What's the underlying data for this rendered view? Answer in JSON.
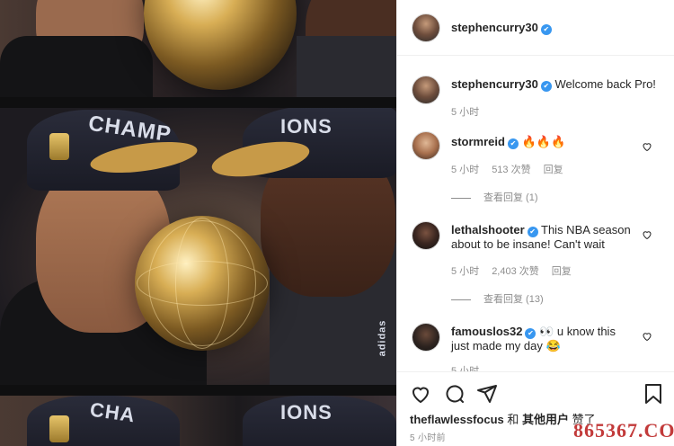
{
  "post": {
    "author": "stephencurry30",
    "caption": "Welcome back Pro!",
    "caption_time": "5 小时",
    "verified_mark": "✔"
  },
  "comments": [
    {
      "user": "stormreid",
      "text": "🔥🔥🔥",
      "time": "5 小时",
      "likes": "513 次赞",
      "reply": "回复",
      "view_replies": "查看回复 (1)"
    },
    {
      "user": "lethalshooter",
      "text": "This NBA season about to be insane! Can't wait",
      "time": "5 小时",
      "likes": "2,403 次赞",
      "reply": "回复",
      "view_replies": "查看回复 (13)"
    },
    {
      "user": "famouslos32",
      "text": "👀 u know this just made my day 😂",
      "time": "5 小时"
    }
  ],
  "liked_by": {
    "user": "theflawlessfocus",
    "joiner": " 和 ",
    "others": "其他用户",
    "suffix": " 赞了"
  },
  "post_time": "5 小时前",
  "watermark": "865367.COM",
  "photo": {
    "cap_text_left": "CHAMP",
    "cap_text_right": "IONS",
    "cap_text_top_left": "CHA",
    "cap_text_top_right": "IONS",
    "jersey_mark": "adidas"
  },
  "colors": {
    "verified": "#3897f0",
    "text_primary": "#262626",
    "text_secondary": "#8e8e8e",
    "watermark": "#c23a3a"
  }
}
